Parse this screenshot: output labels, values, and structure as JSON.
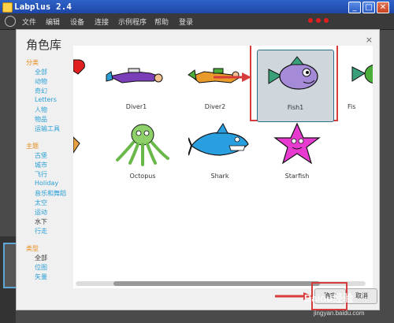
{
  "window": {
    "title": "Labplus 2.4",
    "min": "_",
    "max": "□",
    "close": "✕"
  },
  "menu": [
    "文件",
    "编辑",
    "设备",
    "连接",
    "示例程序",
    "帮助",
    "登录"
  ],
  "dialog": {
    "title": "角色库",
    "close": "×",
    "sections": [
      {
        "heading": "分类",
        "items": [
          "全部",
          "动物",
          "奇幻",
          "Letters",
          "人物",
          "物品",
          "运输工具"
        ]
      },
      {
        "heading": "主题",
        "items": [
          "古堡",
          "城市",
          "飞行",
          "Holiday",
          "音乐和舞蹈",
          "太空",
          "运动",
          "水下",
          "行走"
        ]
      },
      {
        "heading": "类型",
        "items": [
          "全部",
          "位图",
          "矢量"
        ]
      }
    ],
    "selected_items": [
      "水下",
      "全部"
    ],
    "sprites": [
      "Diver1",
      "Diver2",
      "Fish1",
      "Fis",
      "Octopus",
      "Shark",
      "Starfish"
    ],
    "selected_sprite": "Fish1",
    "buttons": {
      "ok": "确定",
      "cancel": "取消"
    }
  },
  "watermark": {
    "line1": "Baidu经验",
    "line2": "jingyan.baidu.com"
  },
  "colors": {
    "titlebar": "#2a56bb",
    "accent_orange": "#e68a1a",
    "link_blue": "#2a9fd6",
    "highlight_red": "#d63c3c"
  }
}
